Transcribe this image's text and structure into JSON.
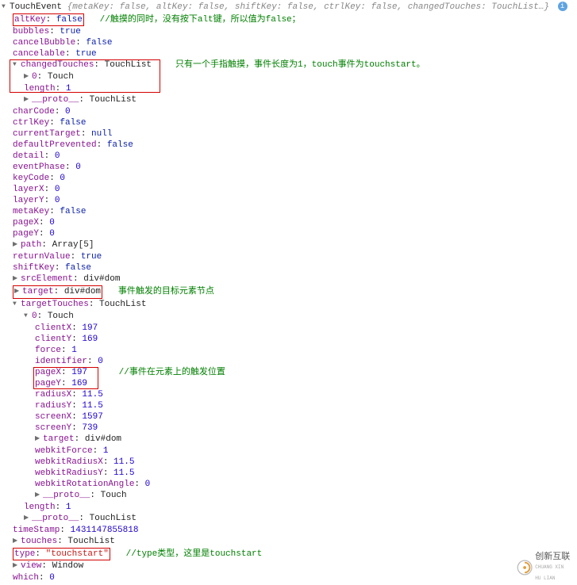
{
  "header": {
    "className": "TouchEvent",
    "preview": "{metaKey: false, altKey: false, shiftKey: false, ctrlKey: false, changedTouches: TouchList…}"
  },
  "altKey": {
    "key": "altKey",
    "value": "false",
    "comment": "//触摸的同时，没有按下alt键，所以值为false；"
  },
  "bubbles": {
    "key": "bubbles",
    "value": "true"
  },
  "cancelBubble": {
    "key": "cancelBubble",
    "value": "false"
  },
  "cancelable": {
    "key": "cancelable",
    "value": "true"
  },
  "changedTouches": {
    "key": "changedTouches",
    "type": "TouchList",
    "item0": {
      "key": "0",
      "type": "Touch"
    },
    "length": {
      "key": "length",
      "value": "1"
    },
    "proto": {
      "key": "__proto__",
      "type": "TouchList"
    },
    "comment": "只有一个手指触摸，事件长度为1，touch事件为touchstart。"
  },
  "charCode": {
    "key": "charCode",
    "value": "0"
  },
  "ctrlKey": {
    "key": "ctrlKey",
    "value": "false"
  },
  "currentTarget": {
    "key": "currentTarget",
    "value": "null"
  },
  "defaultPrevented": {
    "key": "defaultPrevented",
    "value": "false"
  },
  "detail": {
    "key": "detail",
    "value": "0"
  },
  "eventPhase": {
    "key": "eventPhase",
    "value": "0"
  },
  "keyCode": {
    "key": "keyCode",
    "value": "0"
  },
  "layerX": {
    "key": "layerX",
    "value": "0"
  },
  "layerY": {
    "key": "layerY",
    "value": "0"
  },
  "metaKey": {
    "key": "metaKey",
    "value": "false"
  },
  "pageX": {
    "key": "pageX",
    "value": "0"
  },
  "pageY": {
    "key": "pageY",
    "value": "0"
  },
  "path": {
    "key": "path",
    "type": "Array[5]"
  },
  "returnValue": {
    "key": "returnValue",
    "value": "true"
  },
  "shiftKey": {
    "key": "shiftKey",
    "value": "false"
  },
  "srcElement": {
    "key": "srcElement",
    "type": "div#dom"
  },
  "target": {
    "key": "target",
    "type": "div#dom",
    "comment": "事件触发的目标元素节点"
  },
  "targetTouches": {
    "key": "targetTouches",
    "type": "TouchList",
    "item0": {
      "key": "0",
      "type": "Touch",
      "clientX": {
        "key": "clientX",
        "value": "197"
      },
      "clientY": {
        "key": "clientY",
        "value": "169"
      },
      "force": {
        "key": "force",
        "value": "1"
      },
      "identifier": {
        "key": "identifier",
        "value": "0"
      },
      "pageX": {
        "key": "pageX",
        "value": "197"
      },
      "pageY": {
        "key": "pageY",
        "value": "169"
      },
      "pageComment": "//事件在元素上的触发位置",
      "radiusX": {
        "key": "radiusX",
        "value": "11.5"
      },
      "radiusY": {
        "key": "radiusY",
        "value": "11.5"
      },
      "screenX": {
        "key": "screenX",
        "value": "1597"
      },
      "screenY": {
        "key": "screenY",
        "value": "739"
      },
      "target": {
        "key": "target",
        "type": "div#dom"
      },
      "webkitForce": {
        "key": "webkitForce",
        "value": "1"
      },
      "webkitRadiusX": {
        "key": "webkitRadiusX",
        "value": "11.5"
      },
      "webkitRadiusY": {
        "key": "webkitRadiusY",
        "value": "11.5"
      },
      "webkitRotationAngle": {
        "key": "webkitRotationAngle",
        "value": "0"
      },
      "proto": {
        "key": "__proto__",
        "type": "Touch"
      }
    },
    "length": {
      "key": "length",
      "value": "1"
    },
    "proto": {
      "key": "__proto__",
      "type": "TouchList"
    }
  },
  "timeStamp": {
    "key": "timeStamp",
    "value": "1431147855818"
  },
  "touches": {
    "key": "touches",
    "type": "TouchList"
  },
  "type": {
    "key": "type",
    "value": "\"touchstart\"",
    "comment": "//type类型，这里是touchstart"
  },
  "view": {
    "key": "view",
    "type": "Window"
  },
  "which": {
    "key": "which",
    "value": "0"
  },
  "logo": {
    "cn": "创新互联",
    "py": "CHUANG XIN HU LIAN"
  }
}
